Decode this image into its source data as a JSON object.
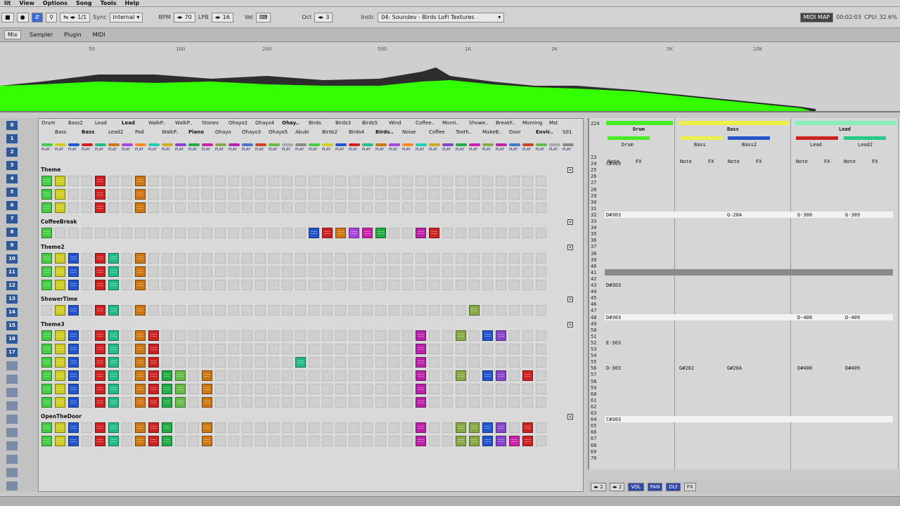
{
  "menu": [
    "lit",
    "View",
    "Options",
    "Song",
    "Tools",
    "Help"
  ],
  "status": {
    "midi": "MIDI MAP",
    "time": "00:02:03",
    "cpu": "CPU: 32.6%"
  },
  "transport": {
    "loop": "1/1",
    "sync_label": "Sync",
    "sync_value": "Internal",
    "bpm_label": "BPM",
    "bpm_value": "70",
    "lpb_label": "LPB",
    "lpb_value": "16",
    "vel_label": "Vel",
    "oct_label": "Oct",
    "oct_value": "3",
    "instr_label": "Instr.",
    "instr_value": "04: Soundev - Birds LoFi Textures"
  },
  "modes": [
    "Mix",
    "Sampler",
    "Plugin",
    "MIDI"
  ],
  "spectrum": {
    "labels": [
      "50",
      "100",
      "200",
      "500",
      "1K",
      "2K",
      "5K",
      "10K"
    ],
    "colors": {
      "fill": "#33ff00",
      "shadow": "#2d2d2d"
    }
  },
  "tracks_row1": [
    "Drum",
    "Bass2",
    "Lead",
    "Lead",
    "WalkP..",
    "WalkP..",
    "Stones",
    "Ohayo2",
    "Ohayo4",
    "Ohay..",
    "Birds",
    "Birds3",
    "Birds5",
    "Wind",
    "Coffee..",
    "Morni..",
    "Showe..",
    "BreakF..",
    "Morning",
    "Mst"
  ],
  "tracks_row2": [
    "Bass",
    "Bass",
    "Lead2",
    "Pad",
    "WalkP..",
    "Piano",
    "Ohayo",
    "Ohayo3",
    "Ohayo5",
    "Akubi",
    "Birds2",
    "Birds4",
    "Birds..",
    "Noise",
    "Coffee",
    "Tooth..",
    "MakeB..",
    "Door",
    "Envir..",
    "S01"
  ],
  "track_colors": [
    "#44cc44",
    "#cccc22",
    "#2255cc",
    "#cc2222",
    "#22bb88",
    "#cc7711",
    "#aa44dd",
    "#ff8822",
    "#22ccaa",
    "#ccaa22",
    "#8844cc",
    "#22aa44",
    "#cc22aa",
    "#88aa44",
    "#bb22aa",
    "#4477cc",
    "#cc4422",
    "#66bb44",
    "#aaaaaa",
    "#888888"
  ],
  "play_label": "PLAY",
  "sequences": [
    {
      "name": "Theme",
      "rows": [
        2,
        3,
        4
      ]
    },
    {
      "name": "CoffeeBreak",
      "rows": [
        5
      ]
    },
    {
      "name": "Theme2",
      "rows": [
        6,
        7,
        8
      ]
    },
    {
      "name": "ShowerTime",
      "rows": [
        9
      ]
    },
    {
      "name": "Theme3",
      "rows": [
        10,
        11,
        12,
        13,
        14,
        15
      ]
    },
    {
      "name": "OpenTheDoor",
      "rows": [
        16,
        17
      ]
    }
  ],
  "pattern": {
    "current_line": "224",
    "columns": [
      {
        "name": "Drum",
        "sub": [
          "Drum"
        ],
        "color": "#44ee22"
      },
      {
        "name": "Bass",
        "sub": [
          "Bass",
          "Bass2"
        ],
        "color": "#eeee44"
      },
      {
        "name": "Lead",
        "sub": [
          "Lead",
          "Lead2"
        ],
        "color": "#88eebb"
      }
    ],
    "note_label": "Note",
    "fx_label": "FX",
    "lines": [
      "23",
      "24",
      "25",
      "26",
      "27",
      "28",
      "29",
      "30",
      "31",
      "32",
      "33",
      "34",
      "35",
      "36",
      "37",
      "38",
      "39",
      "40",
      "41",
      "42",
      "43",
      "44",
      "45",
      "46",
      "47",
      "48",
      "49",
      "50",
      "51",
      "52",
      "53",
      "54",
      "55",
      "56",
      "57",
      "58",
      "59",
      "60",
      "61",
      "62",
      "63",
      "64",
      "65",
      "66",
      "67",
      "68",
      "69",
      "70"
    ],
    "drum_notes": {
      "24": "C#303",
      "32": "D#303",
      "43": "D#303",
      "48": "D#303",
      "52": "E-303",
      "56": "D-303",
      "64": "C#303"
    },
    "bass_notes": {
      "56": "G#202"
    },
    "bass2_notes": {
      "32": "G-20A",
      "56": "G#20A"
    },
    "lead_notes": {
      "32": "G-300",
      "48": "D-400",
      "56": "D#400"
    },
    "lead2_notes": {
      "32": "G-309",
      "48": "D-409",
      "56": "D#409"
    }
  },
  "bottom": {
    "step": "2",
    "edit": "2",
    "buttons": [
      "VOL",
      "PAN",
      "DLY",
      "FX"
    ]
  }
}
